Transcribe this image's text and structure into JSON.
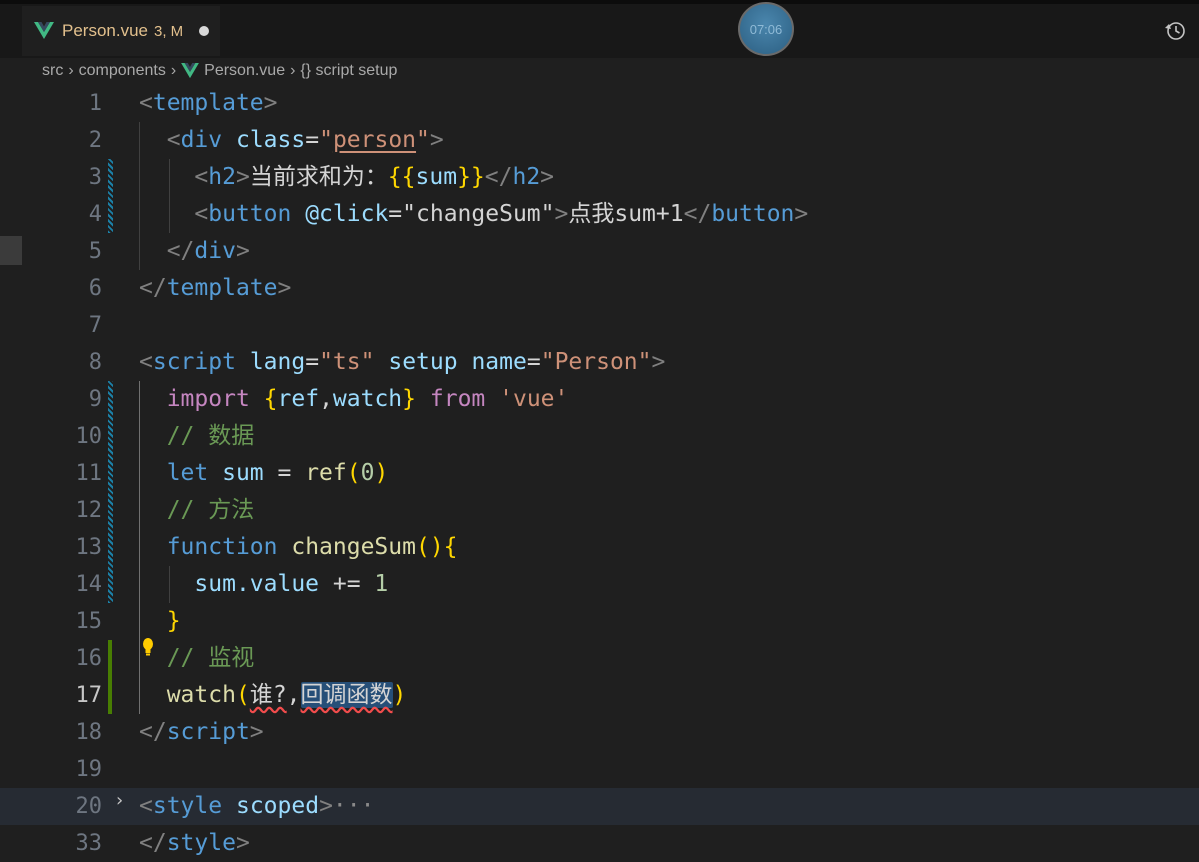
{
  "tab": {
    "filename": "Person.vue",
    "status": "3, M"
  },
  "timer": "07:06",
  "breadcrumb": {
    "src": "src",
    "components": "components",
    "file": "Person.vue",
    "symbol": "{} script setup"
  },
  "lines": {
    "n1": "1",
    "n2": "2",
    "n3": "3",
    "n4": "4",
    "n5": "5",
    "n6": "6",
    "n7": "7",
    "n8": "8",
    "n9": "9",
    "n10": "10",
    "n11": "11",
    "n12": "12",
    "n13": "13",
    "n14": "14",
    "n15": "15",
    "n16": "16",
    "n17": "17",
    "n18": "18",
    "n19": "19",
    "n20": "20",
    "n21": "33"
  },
  "code": {
    "l1_tag": "template",
    "l2_tag": "div",
    "l2_attr": "class",
    "l2_val": "person",
    "l3_tag": "h2",
    "l3_text": "当前求和为：",
    "l3_expr": "sum",
    "l4_tag": "button",
    "l4_attr": "@click",
    "l4_val": "changeSum",
    "l4_text": "点我sum+1",
    "l5_tag": "div",
    "l6_tag": "template",
    "l8_tag": "script",
    "l8_a1": "lang",
    "l8_v1": "ts",
    "l8_a2": "setup",
    "l8_a3": "name",
    "l8_v3": "Person",
    "l9_import": "import",
    "l9_ref": "ref",
    "l9_watch": "watch",
    "l9_from": "from",
    "l9_mod": "'vue'",
    "l10_comment": "// 数据",
    "l11_let": "let",
    "l11_var": "sum",
    "l11_op": " = ",
    "l11_fn": "ref",
    "l11_num": "0",
    "l12_comment": "// 方法",
    "l13_kw": "function",
    "l13_fn": "changeSum",
    "l14_var": "sum",
    "l14_prop": ".value",
    "l14_op": " += ",
    "l14_num": "1",
    "l16_comment": "// 监视",
    "l17_fn": "watch",
    "l17_arg1": "谁?",
    "l17_arg2": "回调函数",
    "l18_tag": "script",
    "l20_tag": "style",
    "l20_attr": "scoped",
    "l20_dots": "···",
    "l21_tag": "style"
  }
}
